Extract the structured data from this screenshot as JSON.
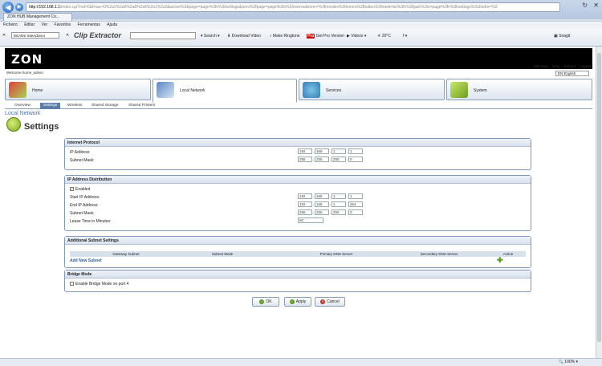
{
  "browser": {
    "url_host": "http://192.168.1.1",
    "url_rest": "/index.cgi?rnd=5&frnac=0%2a2%2a6%2a6%2a6%2a1%2a3&active%3&page=page%3fn%3fsettings&prev%3fpage=page%3fn%3fovervw&mnn=%3fmnrdev%3fnnmrs%3fbutton%3fmeld=bn%3fn%3fgatc%3fz=page%3fn%3fsettings%2a0ndrs=%3",
    "tab_title": "ZON HUB Management Co...",
    "menu": [
      "Ficheiro",
      "Editar",
      "Ver",
      "Favoritos",
      "Ferramentas",
      "Ajuda"
    ],
    "toolbar": {
      "mcafee": "McAfee SiteAdvisor",
      "clip": "Clip Extractor",
      "search": "Search",
      "download": "Download Video",
      "ringtone": "Make Ringtone",
      "pro": "Pro",
      "pro_version": "Get Pro Version",
      "videos": "Videos",
      "temp": "20°C",
      "snagit": "Snagit"
    },
    "zoom": "100%"
  },
  "app": {
    "logo": "ZON",
    "top_links": [
      "Site Map",
      "Help",
      "Reboot",
      "Logout"
    ],
    "welcome": "Welcome home_admin",
    "language": "EN English",
    "main_tabs": [
      "Home",
      "Local Network",
      "Services",
      "System"
    ],
    "sub_tabs": [
      "Overview",
      "Settings",
      "Wireless",
      "Shared Storage",
      "Shared Printers"
    ],
    "breadcrumb": "Local Network",
    "page_title": "Settings"
  },
  "sections": {
    "ip": {
      "title": "Internet Protocol",
      "ip_label": "IP Address:",
      "ip": [
        "192",
        "168",
        "1",
        "1"
      ],
      "mask_label": "Subnet Mask:",
      "mask": [
        "255",
        "255",
        "255",
        "0"
      ]
    },
    "dhcp": {
      "title": "IP Address Distribution",
      "enabled_label": "Enabled",
      "start_label": "Start IP Address:",
      "start": [
        "192",
        "168",
        "1",
        "1"
      ],
      "end_label": "End IP Address:",
      "end": [
        "192",
        "168",
        "1",
        "254"
      ],
      "mask_label": "Subnet Mask:",
      "mask": [
        "255",
        "255",
        "255",
        "0"
      ],
      "lease_label": "Lease Time in Minutes:",
      "lease": "60"
    },
    "subnet": {
      "title": "Additional Subnet Settings",
      "columns": [
        "Gateway Subnet",
        "Subnet Mask",
        "Primary DNS Server",
        "Secondary DNS Server",
        "Action"
      ],
      "add_link": "Add New Subnet"
    },
    "bridge": {
      "title": "Bridge Mode",
      "checkbox_label": "Enable Bridge Mode on port 4"
    }
  },
  "buttons": {
    "ok": "OK",
    "apply": "Apply",
    "cancel": "Cancel"
  },
  "colors": {
    "accent": "#5b7dab",
    "header_bg": "#000000",
    "link": "#2d5fa0"
  }
}
